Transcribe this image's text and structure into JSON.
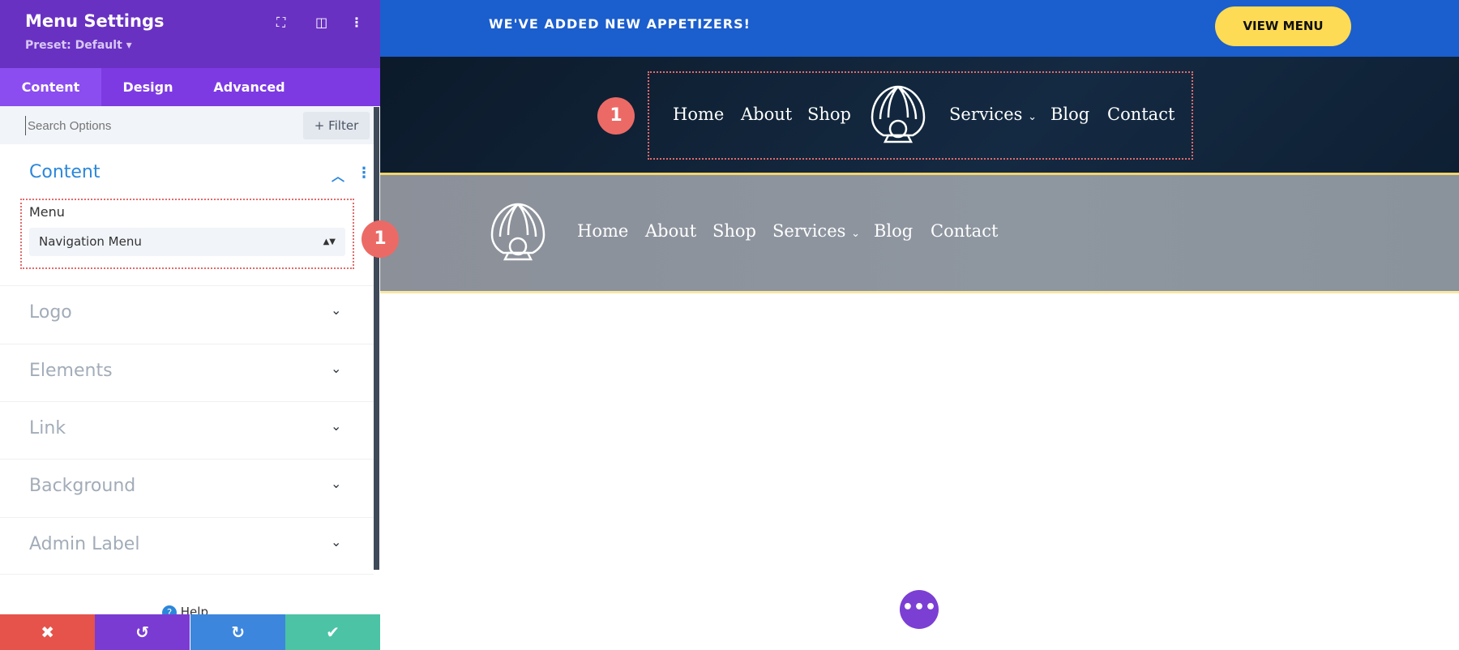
{
  "sidebar": {
    "title": "Menu Settings",
    "preset": "Preset: Default ▾",
    "tabs": [
      "Content",
      "Design",
      "Advanced"
    ],
    "search_placeholder": "Search Options",
    "filter_label": "+ Filter",
    "section_title": "Content",
    "menu_label": "Menu",
    "menu_value": "Navigation Menu",
    "sections": [
      "Logo",
      "Elements",
      "Link",
      "Background",
      "Admin Label"
    ],
    "help": "Help"
  },
  "annotation": "1",
  "site": {
    "promo": "WE'VE ADDED NEW APPETIZERS!",
    "cta": "VIEW MENU",
    "nav": [
      "Home",
      "About",
      "Shop",
      "Services",
      "Blog",
      "Contact"
    ]
  },
  "colors": {
    "purple": "#6931c2",
    "blue": "#1b5ecd",
    "yellow": "#fddb55"
  }
}
